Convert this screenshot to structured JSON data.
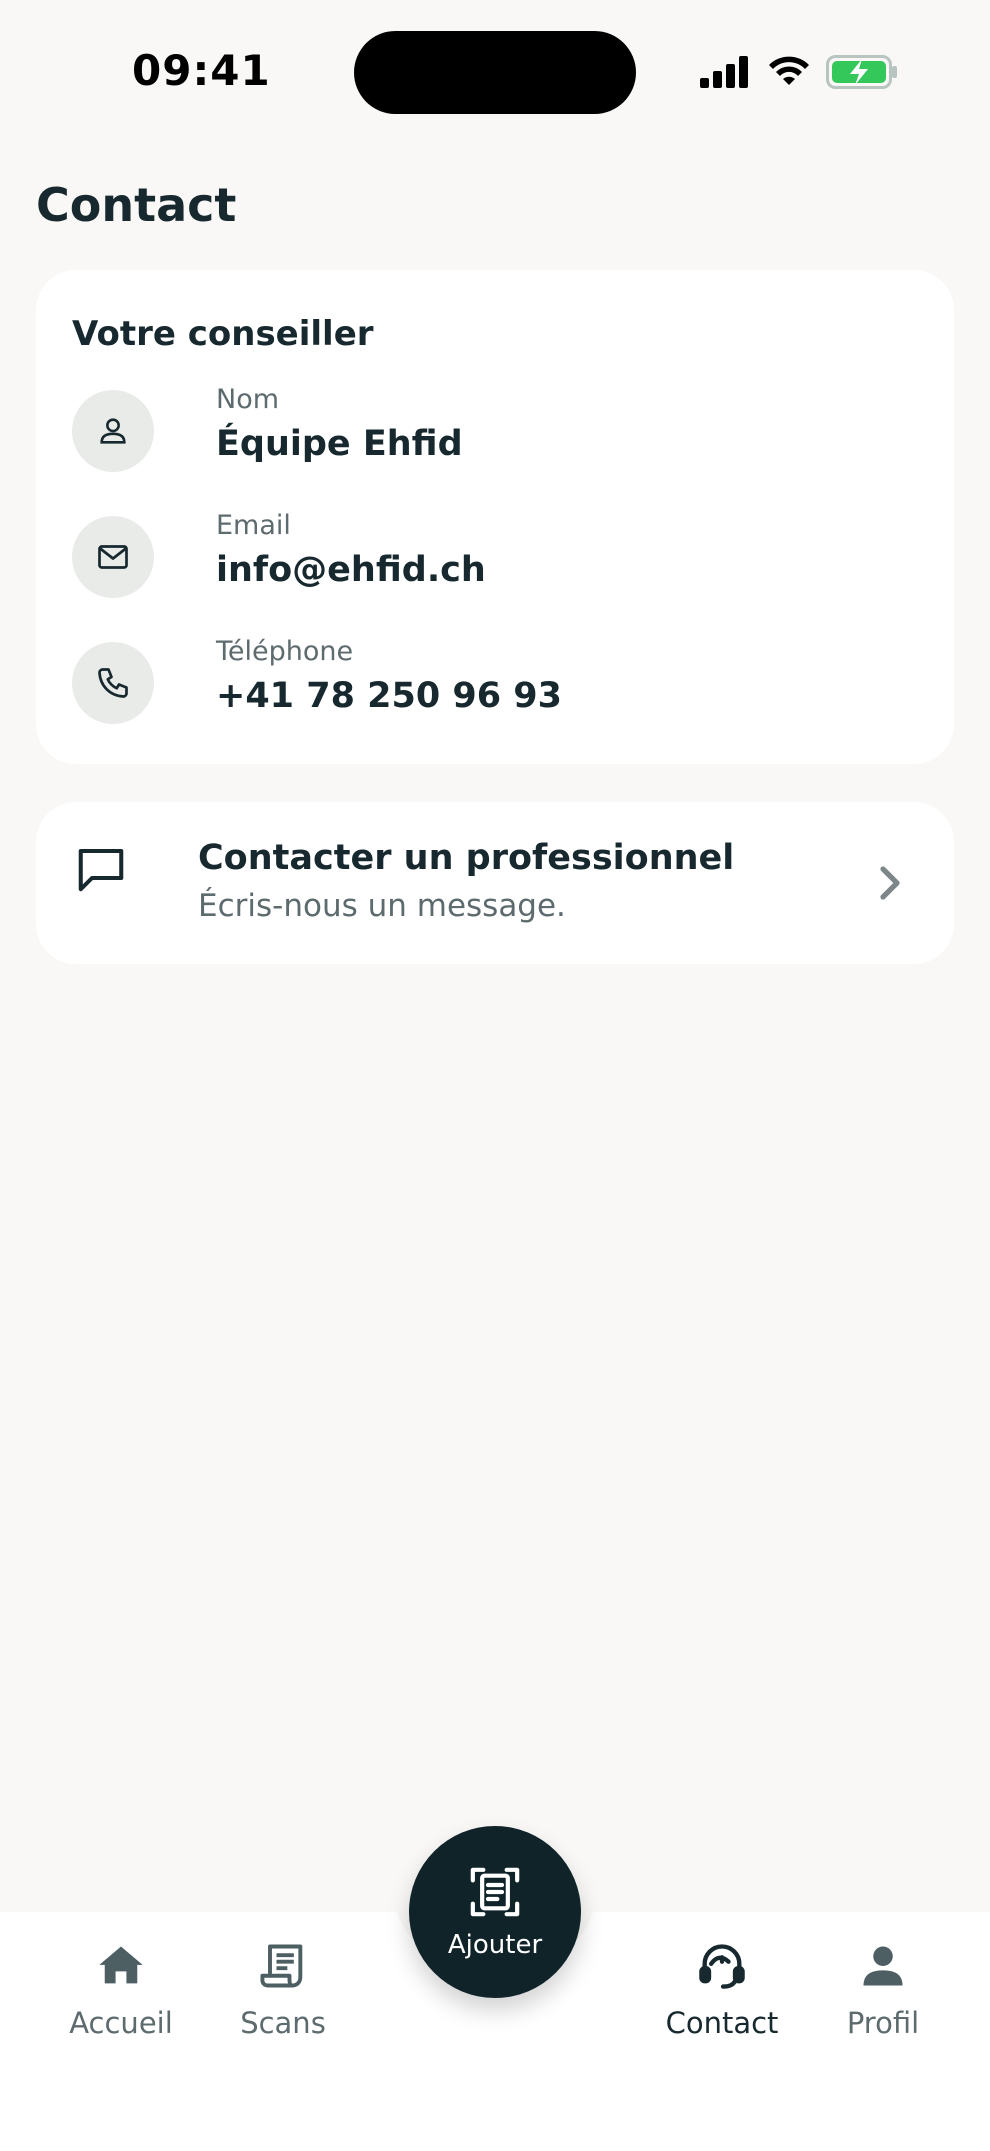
{
  "status_bar": {
    "time": "09:41"
  },
  "page": {
    "title": "Contact"
  },
  "advisor_card": {
    "title": "Votre conseiller",
    "rows": [
      {
        "label": "Nom",
        "value": "Équipe Ehfid",
        "icon": "person-icon"
      },
      {
        "label": "Email",
        "value": "info@ehfid.ch",
        "icon": "mail-icon"
      },
      {
        "label": "Téléphone",
        "value": "+41 78 250 96 93",
        "icon": "phone-icon"
      }
    ]
  },
  "pro_card": {
    "title": "Contacter un professionnel",
    "subtitle": "Écris-nous un message.",
    "icon": "chat-bubble-icon"
  },
  "nav": {
    "items": [
      {
        "label": "Accueil",
        "icon": "home-icon",
        "active": false
      },
      {
        "label": "Scans",
        "icon": "receipt-icon",
        "active": false
      },
      {
        "label": "Contact",
        "icon": "headset-icon",
        "active": true
      },
      {
        "label": "Profil",
        "icon": "person-icon",
        "active": false
      }
    ],
    "fab_label": "Ajouter"
  },
  "colors": {
    "background": "#f9f8f6",
    "card": "#ffffff",
    "text_primary": "#17292f",
    "text_secondary": "#5d6b6e",
    "fab": "#0f2329",
    "battery": "#34c759"
  }
}
